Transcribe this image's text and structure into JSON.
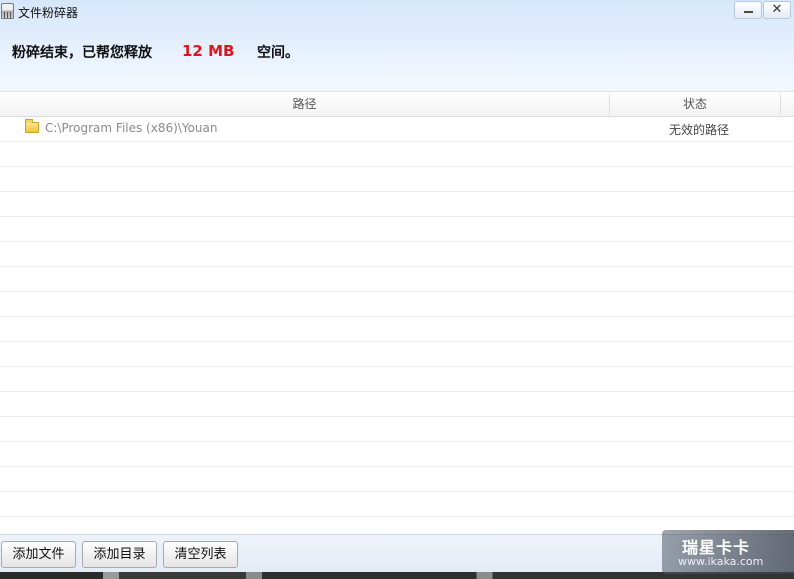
{
  "window": {
    "title": "文件粉碎器",
    "close_glyph": "✕"
  },
  "banner": {
    "prefix": "粉碎结束，已帮您释放",
    "size": "12 MB",
    "suffix": "空间。"
  },
  "table": {
    "columns": [
      "路径",
      "状态"
    ],
    "rows": [
      {
        "icon": "folder-icon",
        "path": "C:\\Program Files (x86)\\Youan",
        "status": "无效的路径"
      }
    ],
    "empty_rows": 16
  },
  "footer": {
    "buttons": [
      "添加文件",
      "添加目录",
      "清空列表"
    ]
  },
  "watermark": {
    "title": "瑞星卡卡",
    "url": "www.ikaka.com"
  },
  "colors": {
    "size_highlight": "#e0141e",
    "header_gradient_top": "#d6e6fa"
  }
}
